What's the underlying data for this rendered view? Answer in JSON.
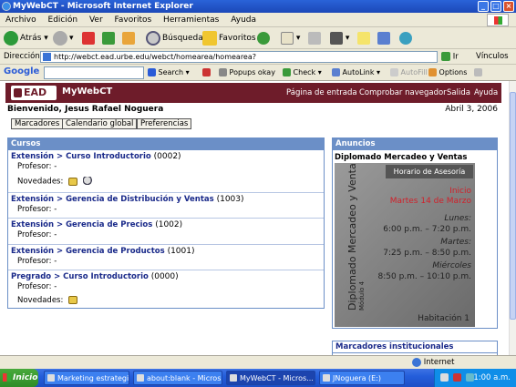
{
  "window": {
    "title": "MyWebCT - Microsoft Internet Explorer"
  },
  "menubar": {
    "items": [
      "Archivo",
      "Edición",
      "Ver",
      "Favoritos",
      "Herramientas",
      "Ayuda"
    ]
  },
  "toolbar": {
    "back": "Atrás",
    "search": "Búsqueda",
    "favorites": "Favoritos"
  },
  "address": {
    "label": "Dirección",
    "url": "http://webct.ead.urbe.edu/webct/homearea/homearea?",
    "go": "Ir",
    "links": "Vínculos"
  },
  "googlebar": {
    "logo": "Google",
    "search": "Search",
    "popups": "Popups okay",
    "check": "Check",
    "autolink": "AutoLink",
    "autofill": "AutoFill",
    "options": "Options"
  },
  "webct": {
    "logo": "EAD",
    "app": "MyWebCT",
    "links": [
      "Página de entrada",
      "Comprobar navegador",
      "Salida",
      "Ayuda"
    ],
    "welcome": "Bienvenido, Jesus Rafael Noguera",
    "date": "Abril 3, 2006",
    "buttons": [
      "Marcadores",
      "Calendario global",
      "Preferencias"
    ]
  },
  "cursos": {
    "title": "Cursos",
    "rows": [
      {
        "title": "Extensión > Curso Introductorio",
        "code": "(0002)",
        "profesor": "Profesor: -",
        "novedades": "Novedades:"
      },
      {
        "title": "Extensión > Gerencia de Distribución y Ventas",
        "code": "(1003)",
        "profesor": "Profesor: -"
      },
      {
        "title": "Extensión > Gerencia de Precios",
        "code": "(1002)",
        "profesor": "Profesor: -"
      },
      {
        "title": "Extensión > Gerencia de Productos",
        "code": "(1001)",
        "profesor": "Profesor: -"
      },
      {
        "title": "Pregrado > Curso Introductorio",
        "code": "(0000)",
        "profesor": "Profesor: -",
        "novedades": "Novedades:"
      }
    ]
  },
  "anuncios": {
    "title": "Anuncios",
    "subtitle": "Diplomado Mercadeo y Ventas",
    "poster": {
      "header": "Horario de Asesoría",
      "inicio": "Inicio",
      "fecha": "Martes 14 de Marzo",
      "lunes": "Lunes:",
      "lunes_h": "6:00 p.m. – 7:20 p.m.",
      "martes": "Martes:",
      "martes_h": "7:25 p.m. – 8:50 p.m.",
      "miercoles": "Miércoles",
      "miercoles_h": "8:50 p.m. – 10:10 p.m.",
      "vertical": "Diplomado Mercadeo y Ventas",
      "modulo": "Módulo 4",
      "habitacion": "Habitación 1"
    }
  },
  "marcadores": {
    "title": "Marcadores institucionales"
  },
  "statusbar": {
    "zone": "Internet"
  },
  "taskbar": {
    "start": "Inicio",
    "tasks": [
      "Marketing estrategic...",
      "about:blank - Micros...",
      "MyWebCT - Micros...",
      "JNoguera (E:)"
    ],
    "clock": "01:00 a.m."
  }
}
